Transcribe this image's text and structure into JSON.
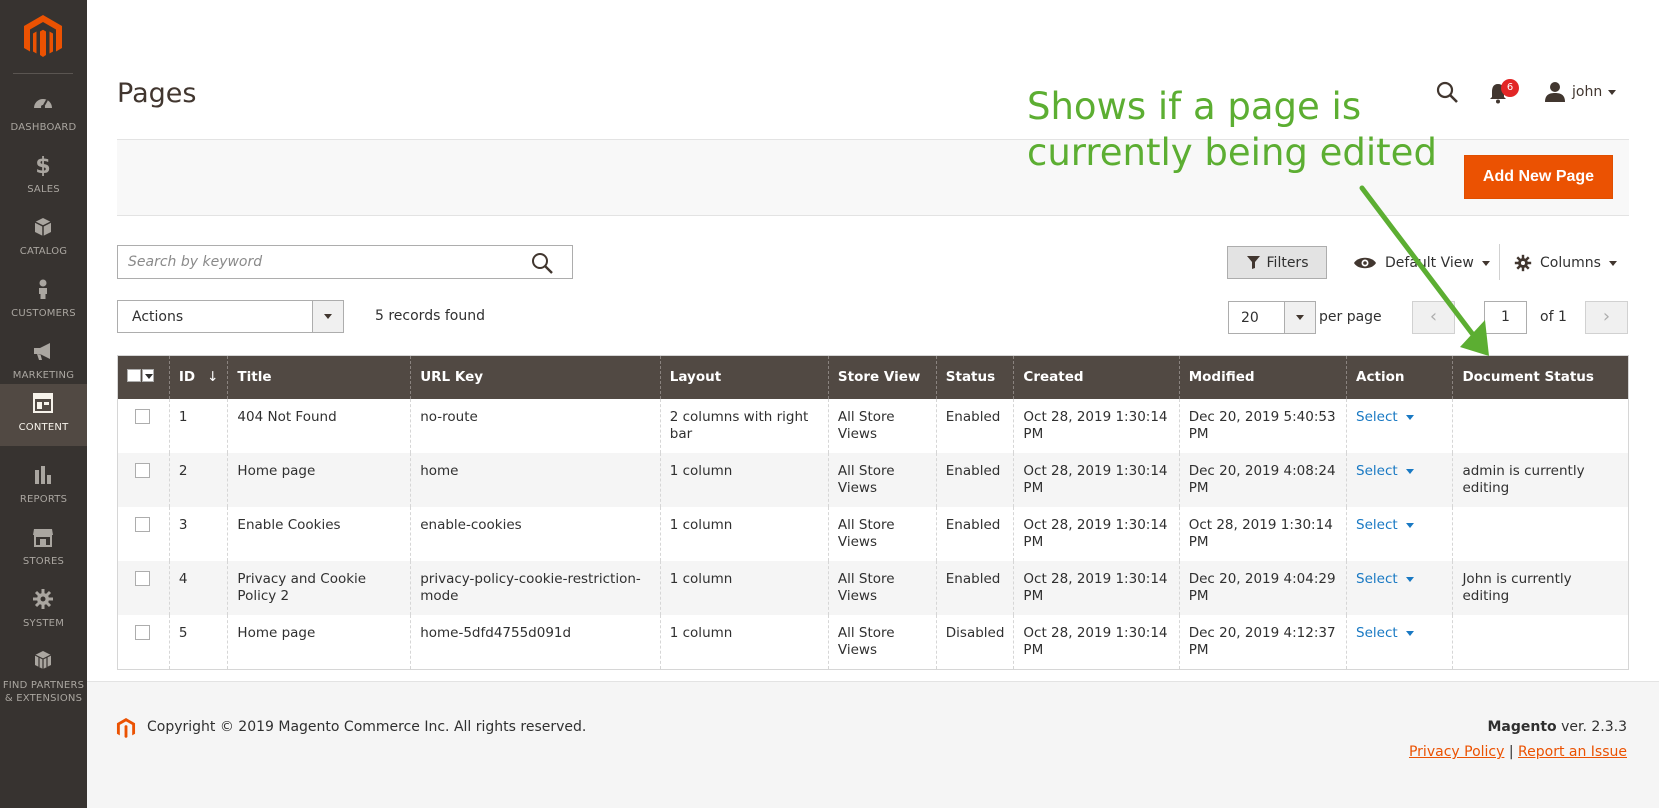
{
  "sidebar": {
    "items": [
      {
        "label": "DASHBOARD",
        "icon": "dashboard-icon"
      },
      {
        "label": "SALES",
        "icon": "dollar-icon"
      },
      {
        "label": "CATALOG",
        "icon": "cube-icon"
      },
      {
        "label": "CUSTOMERS",
        "icon": "person-icon"
      },
      {
        "label": "MARKETING",
        "icon": "megaphone-icon"
      },
      {
        "label": "CONTENT",
        "icon": "layout-icon",
        "active": true
      },
      {
        "label": "REPORTS",
        "icon": "bar-chart-icon"
      },
      {
        "label": "STORES",
        "icon": "storefront-icon"
      },
      {
        "label": "SYSTEM",
        "icon": "gear-icon"
      },
      {
        "label": "FIND PARTNERS",
        "label2": "& EXTENSIONS",
        "icon": "boxes-icon"
      }
    ]
  },
  "header": {
    "title": "Pages",
    "notifications_count": "6",
    "user": "john"
  },
  "annotation": {
    "line1": "Shows if a page is",
    "line2": "currently being edited",
    "color": "#5cae32"
  },
  "toolbar": {
    "add_new_label": "Add New Page",
    "search_placeholder": "Search by keyword",
    "filters_label": "Filters",
    "view_label": "Default View",
    "columns_label": "Columns",
    "actions_label": "Actions",
    "records_found": "5 records found",
    "per_page_value": "20",
    "per_page_label": "per page",
    "page_value": "1",
    "page_of": "of 1"
  },
  "grid": {
    "columns": [
      "ID",
      "Title",
      "URL Key",
      "Layout",
      "Store View",
      "Status",
      "Created",
      "Modified",
      "Action",
      "Document Status"
    ],
    "sort_indicator": "↓",
    "rows": [
      {
        "id": "1",
        "title": "404 Not Found",
        "url_key": "no-route",
        "layout": "2 columns with right bar",
        "store_view": "All Store Views",
        "status": "Enabled",
        "created": "Oct 28, 2019 1:30:14 PM",
        "modified": "Dec 20, 2019 5:40:53 PM",
        "action": "Select",
        "doc_status": ""
      },
      {
        "id": "2",
        "title": "Home page",
        "url_key": "home",
        "layout": "1 column",
        "store_view": "All Store Views",
        "status": "Enabled",
        "created": "Oct 28, 2019 1:30:14 PM",
        "modified": "Dec 20, 2019 4:08:24 PM",
        "action": "Select",
        "doc_status": "admin is currently editing"
      },
      {
        "id": "3",
        "title": "Enable Cookies",
        "url_key": "enable-cookies",
        "layout": "1 column",
        "store_view": "All Store Views",
        "status": "Enabled",
        "created": "Oct 28, 2019 1:30:14 PM",
        "modified": "Oct 28, 2019 1:30:14 PM",
        "action": "Select",
        "doc_status": ""
      },
      {
        "id": "4",
        "title": "Privacy and Cookie Policy 2",
        "url_key": "privacy-policy-cookie-restriction-mode",
        "layout": "1 column",
        "store_view": "All Store Views",
        "status": "Enabled",
        "created": "Oct 28, 2019 1:30:14 PM",
        "modified": "Dec 20, 2019 4:04:29 PM",
        "action": "Select",
        "doc_status": "John is currently editing"
      },
      {
        "id": "5",
        "title": "Home page",
        "url_key": "home-5dfd4755d091d",
        "layout": "1 column",
        "store_view": "All Store Views",
        "status": "Disabled",
        "created": "Oct 28, 2019 1:30:14 PM",
        "modified": "Dec 20, 2019 4:12:37 PM",
        "action": "Select",
        "doc_status": ""
      }
    ]
  },
  "footer": {
    "copyright": "Copyright © 2019 Magento Commerce Inc. All rights reserved.",
    "brand": "Magento",
    "version": " ver. 2.3.3",
    "privacy_link": "Privacy Policy",
    "separator": "|",
    "report_link": "Report an Issue"
  },
  "colors": {
    "sidebar_bg": "#373330",
    "sidebar_active": "#514943",
    "accent": "#eb5202",
    "grid_header": "#514943",
    "link": "#1979c3"
  }
}
